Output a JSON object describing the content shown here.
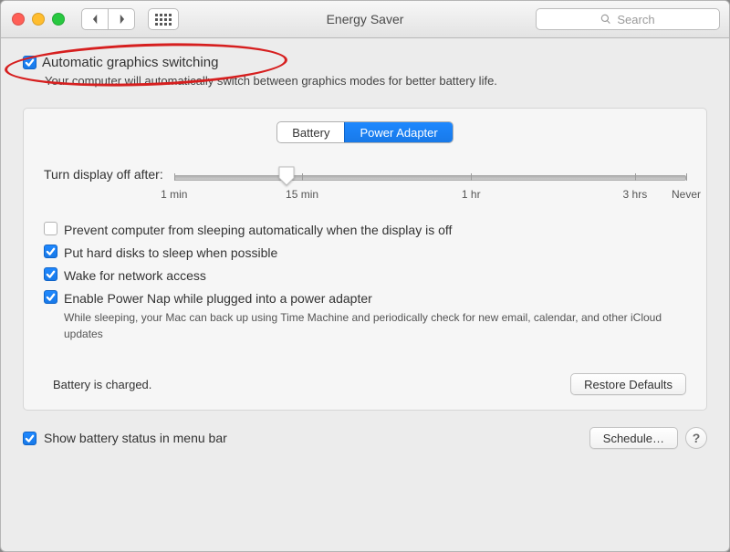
{
  "window": {
    "title": "Energy Saver"
  },
  "search": {
    "placeholder": "Search"
  },
  "autoGraphics": {
    "label": "Automatic graphics switching",
    "checked": true,
    "description": "Your computer will automatically switch between graphics modes for better battery life."
  },
  "tabs": {
    "battery": "Battery",
    "powerAdapter": "Power Adapter",
    "active": "powerAdapter"
  },
  "slider": {
    "label": "Turn display off after:",
    "ticks": [
      "1 min",
      "15 min",
      "1 hr",
      "3 hrs",
      "Never"
    ],
    "valuePercent": 22
  },
  "options": [
    {
      "key": "preventSleep",
      "checked": false,
      "label": "Prevent computer from sleeping automatically when the display is off"
    },
    {
      "key": "hdSleep",
      "checked": true,
      "label": "Put hard disks to sleep when possible"
    },
    {
      "key": "wakeNet",
      "checked": true,
      "label": "Wake for network access"
    },
    {
      "key": "powerNap",
      "checked": true,
      "label": "Enable Power Nap while plugged into a power adapter",
      "desc": "While sleeping, your Mac can back up using Time Machine and periodically check for new email, calendar, and other iCloud updates"
    }
  ],
  "status": "Battery is charged.",
  "buttons": {
    "restoreDefaults": "Restore Defaults",
    "schedule": "Schedule…"
  },
  "footer": {
    "showBatteryStatus": {
      "checked": true,
      "label": "Show battery status in menu bar"
    }
  },
  "help": "?"
}
